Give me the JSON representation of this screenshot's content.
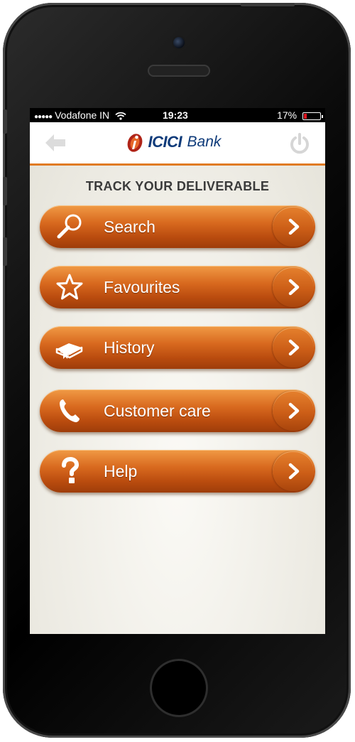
{
  "status_bar": {
    "signal": "●●●●●",
    "carrier": "Vodafone IN",
    "wifi_icon": "wifi-icon",
    "time": "19:23",
    "battery_percent": "17%",
    "battery_level": 0.17,
    "battery_color": "#e0141e"
  },
  "header": {
    "back_icon": "back-arrow-icon",
    "logo_text_a": "ICICI",
    "logo_text_b": "Bank",
    "power_icon": "power-icon"
  },
  "page": {
    "title": "TRACK YOUR DELIVERABLE"
  },
  "menu": {
    "items": [
      {
        "label": "Search",
        "icon": "search-icon"
      },
      {
        "label": "Favourites",
        "icon": "star-icon"
      },
      {
        "label": "History",
        "icon": "book-icon"
      },
      {
        "label": "Customer care",
        "icon": "phone-icon"
      },
      {
        "label": "Help",
        "icon": "question-icon"
      }
    ]
  },
  "colors": {
    "accent": "#e07b24",
    "brand_blue": "#0f3b7a",
    "button_top": "#f09a45",
    "button_bottom": "#9e3d0a"
  }
}
